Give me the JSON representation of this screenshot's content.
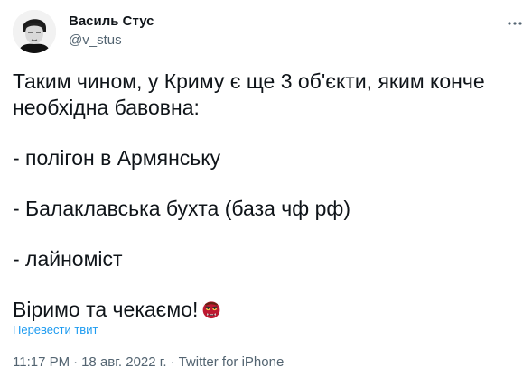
{
  "author": {
    "name": "Василь Стус",
    "handle": "@v_stus"
  },
  "tweet": {
    "lines": [
      "Таким чином, у Криму є ще 3 об'єкти, яким конче",
      "необхідна бавовна:",
      "- полігон в Армянську",
      "- Балаклавська бухта (база чф рф)",
      "- лайноміст",
      "Віримо та чекаємо!"
    ],
    "emoji": "ogre-face"
  },
  "translate_label": "Перевести твит",
  "meta": {
    "time": "11:17 PM",
    "date": "18 авг. 2022 г.",
    "separator": "·",
    "source": "Twitter for iPhone"
  },
  "icons": {
    "more": "more-dots-icon",
    "avatar": "avatar-portrait"
  },
  "colors": {
    "text": "#0f1419",
    "secondary": "#536471",
    "link": "#1d9bf0"
  }
}
